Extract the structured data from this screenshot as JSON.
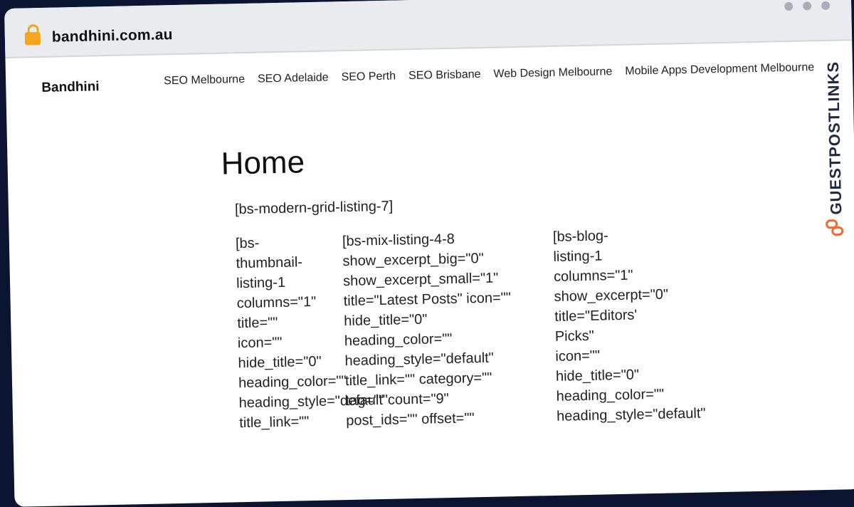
{
  "browser": {
    "url": "bandhini.com.au"
  },
  "site": {
    "brand": "Bandhini",
    "nav": [
      "SEO Melbourne",
      "SEO Adelaide",
      "SEO Perth",
      "SEO Brisbane",
      "Web Design Melbourne",
      "Mobile Apps Development Melbourne"
    ]
  },
  "page": {
    "title": "Home",
    "shortcode_top": "[bs-modern-grid-listing-7]",
    "columns": {
      "col1": [
        "[bs-",
        "thumbnail-",
        "listing-1",
        "columns=\"1\"",
        "title=\"\"",
        "icon=\"\"",
        "hide_title=\"0\"",
        "heading_color=\"\"",
        "heading_style=\"default\"",
        "title_link=\"\""
      ],
      "col2": [
        "[bs-mix-listing-4-8",
        "show_excerpt_big=\"0\"",
        "show_excerpt_small=\"1\"",
        "title=\"Latest Posts\" icon=\"\"",
        "hide_title=\"0\"",
        "heading_color=\"\"",
        "heading_style=\"default\"",
        "title_link=\"\" category=\"\"",
        "tag=\"\" count=\"9\"",
        "post_ids=\"\" offset=\"\""
      ],
      "col3": [
        "[bs-blog-",
        "listing-1",
        "columns=\"1\"",
        "show_excerpt=\"0\"",
        "title=\"Editors'",
        "Picks\"",
        "icon=\"\"",
        "hide_title=\"0\"",
        "heading_color=\"\"",
        "heading_style=\"default\""
      ]
    }
  },
  "watermark": {
    "text": "GUESTPOSTLINKS",
    "icon": "link-chain-icon",
    "accent": "#f06a35",
    "color": "#1f2a44"
  }
}
